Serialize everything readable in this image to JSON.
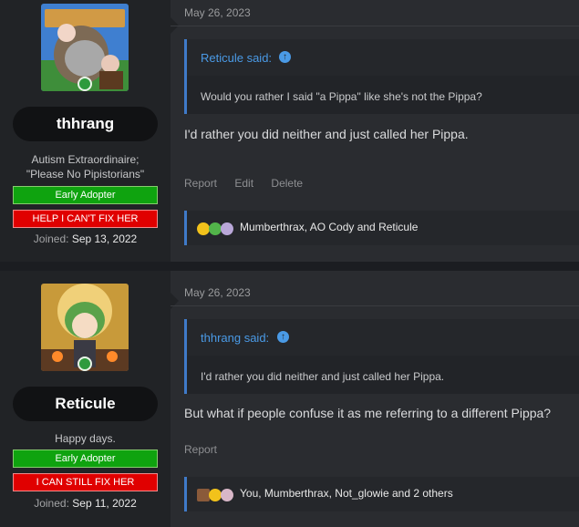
{
  "posts": [
    {
      "user": {
        "name": "thhrang",
        "title_lines": [
          "Autism Extraordinaire;",
          "\"Please No Pipistorians\""
        ],
        "banners": [
          "Early Adopter",
          "HELP I CAN'T FIX HER"
        ],
        "joined_label": "Joined:",
        "joined_date": "Sep 13, 2022"
      },
      "date": "May 26, 2023",
      "quote": {
        "author": "Reticule said:",
        "text": "Would you rather I said \"a Pippa\" like she's not the Pippa?"
      },
      "message": "I'd rather you did neither and just called her Pippa.",
      "actions": [
        "Report",
        "Edit",
        "Delete"
      ],
      "reactions": {
        "names": "Mumberthrax, AO Cody and Reticule",
        "emoji": [
          "thinking-emoji",
          "check-emoji",
          "pipa-emoji"
        ]
      }
    },
    {
      "user": {
        "name": "Reticule",
        "title_lines": [
          "Happy days."
        ],
        "banners": [
          "Early Adopter",
          "I CAN STILL FIX HER"
        ],
        "joined_label": "Joined:",
        "joined_date": "Sep 11, 2022"
      },
      "date": "May 26, 2023",
      "quote": {
        "author": "thhrang said:",
        "text": "I'd rather you did neither and just called her Pippa."
      },
      "message": "But what if people confuse it as me referring to a different Pippa?",
      "actions": [
        "Report"
      ],
      "reactions": {
        "names": "You, Mumberthrax, Not_glowie and 2 others",
        "emoji": [
          "chocolate-emoji",
          "thinking-emoji",
          "pipa-emoji"
        ]
      }
    }
  ]
}
